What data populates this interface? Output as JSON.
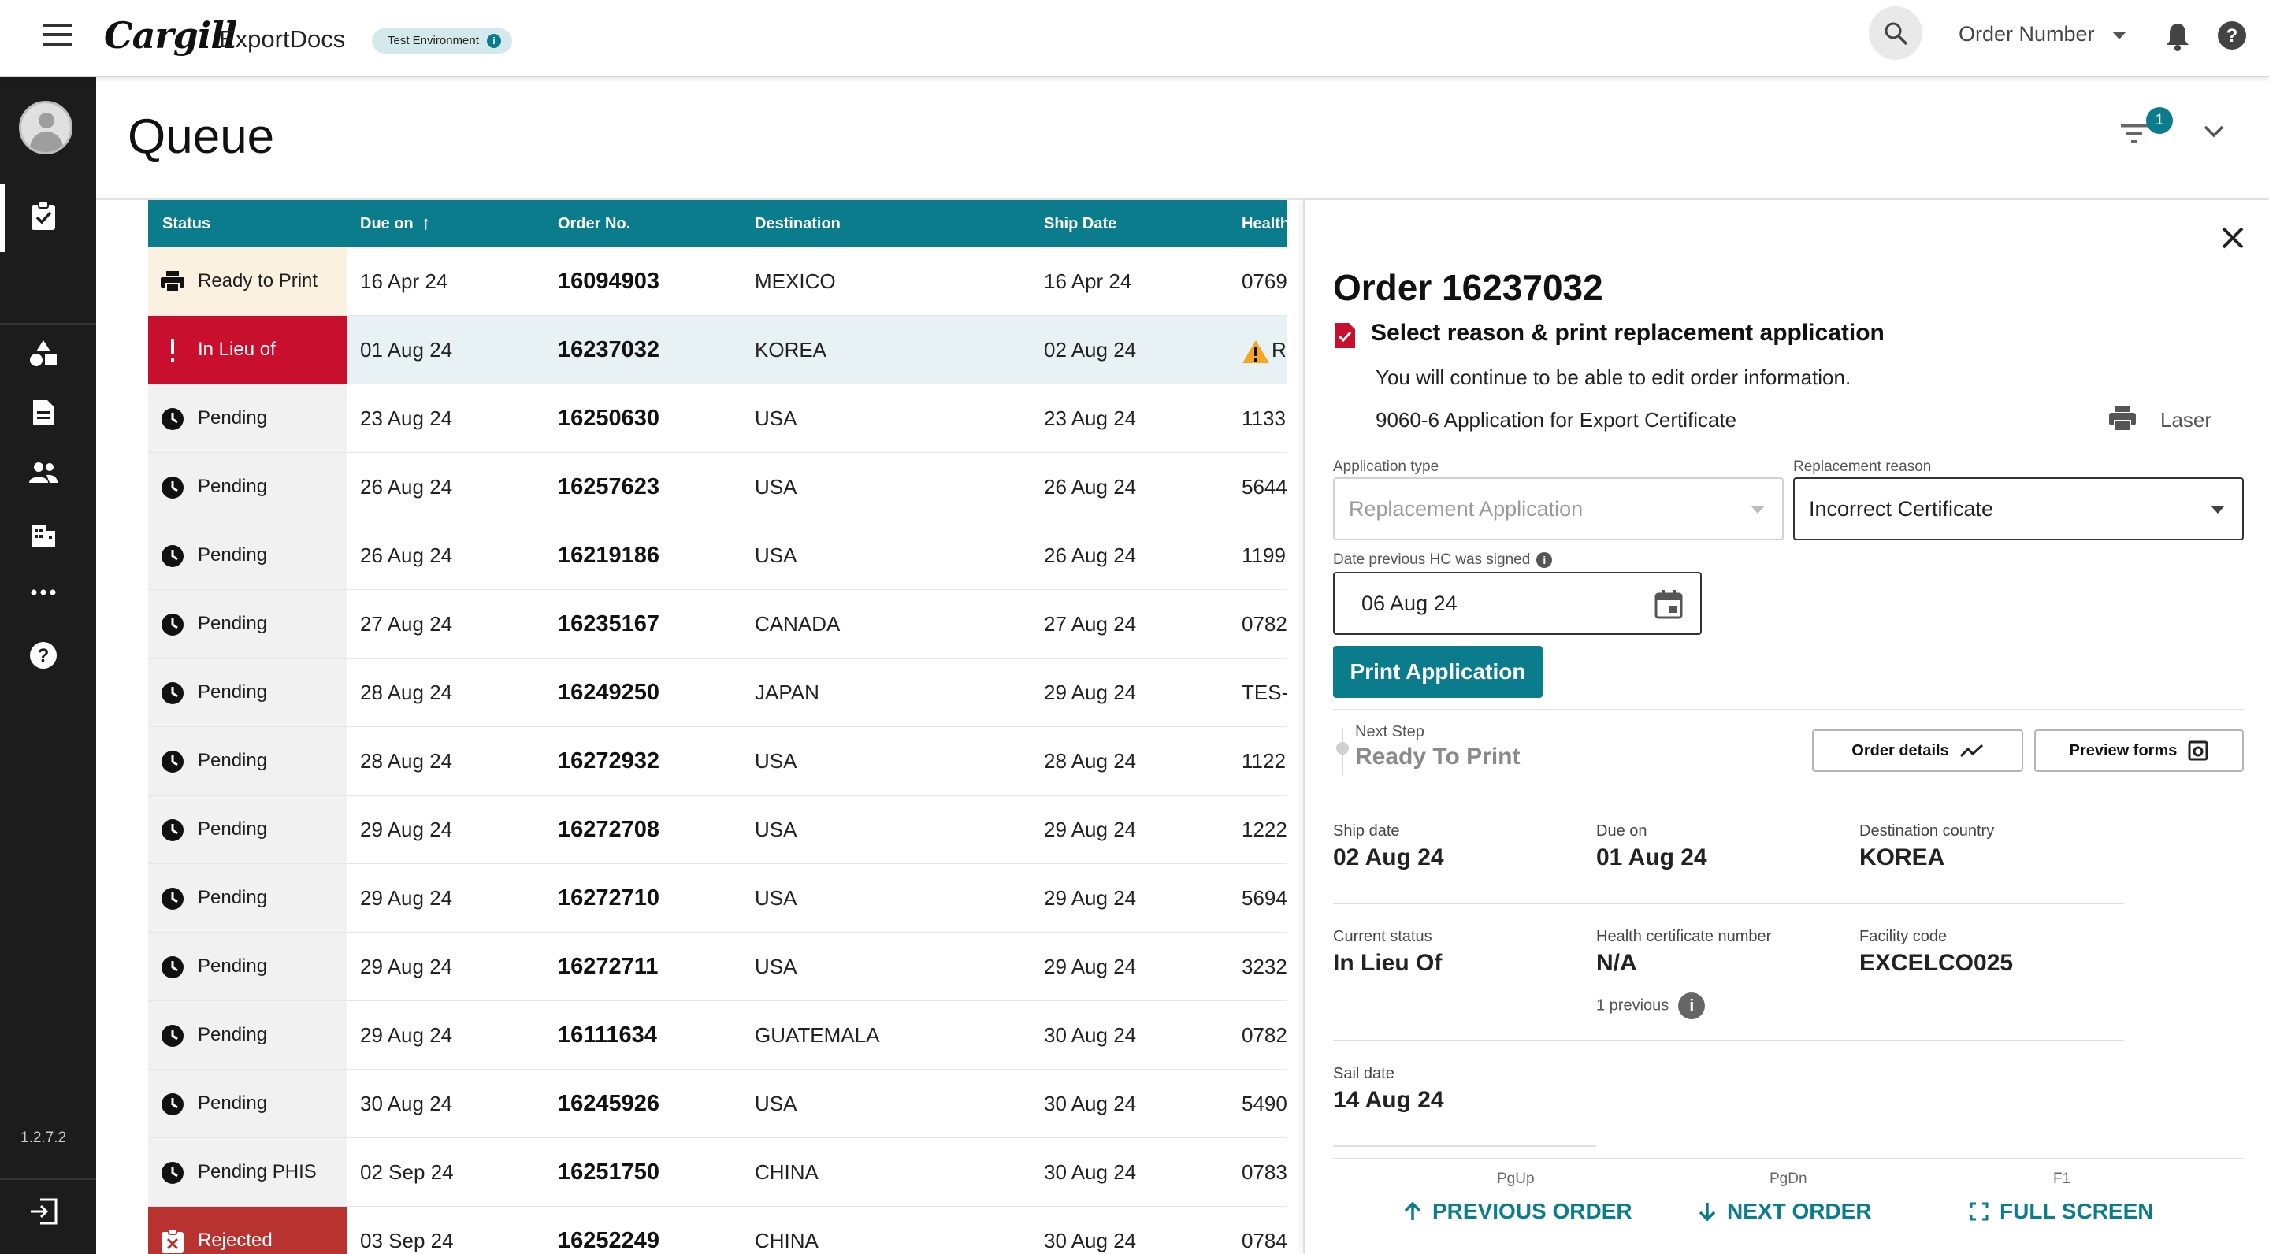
{
  "header": {
    "brand": "Cargill",
    "app_name": "ExportDocs",
    "env_badge": "Test Environment",
    "order_search_label": "Order Number"
  },
  "sidebar": {
    "version": "1.2.7.2",
    "items": [
      {
        "icon": "task-check-icon"
      },
      {
        "icon": "shapes-icon"
      },
      {
        "icon": "document-icon"
      },
      {
        "icon": "people-icon"
      },
      {
        "icon": "building-icon"
      },
      {
        "icon": "more-icon"
      },
      {
        "icon": "help-icon"
      },
      {
        "icon": "logout-icon"
      }
    ]
  },
  "page": {
    "title": "Queue",
    "filter_count": "1"
  },
  "table": {
    "columns": [
      "Status",
      "Due on",
      "Order No.",
      "Destination",
      "Ship Date",
      "Health"
    ],
    "rows": [
      {
        "status": "Ready to Print",
        "due": "16 Apr 24",
        "order": "16094903",
        "dest": "MEXICO",
        "ship": "16 Apr 24",
        "health": "0769"
      },
      {
        "status": "In Lieu of",
        "due": "01 Aug 24",
        "order": "16237032",
        "dest": "KOREA",
        "ship": "02 Aug 24",
        "health": "R"
      },
      {
        "status": "Pending",
        "due": "23 Aug 24",
        "order": "16250630",
        "dest": "USA",
        "ship": "23 Aug 24",
        "health": "1133"
      },
      {
        "status": "Pending",
        "due": "26 Aug 24",
        "order": "16257623",
        "dest": "USA",
        "ship": "26 Aug 24",
        "health": "5644"
      },
      {
        "status": "Pending",
        "due": "26 Aug 24",
        "order": "16219186",
        "dest": "USA",
        "ship": "26 Aug 24",
        "health": "1199"
      },
      {
        "status": "Pending",
        "due": "27 Aug 24",
        "order": "16235167",
        "dest": "CANADA",
        "ship": "27 Aug 24",
        "health": "0782"
      },
      {
        "status": "Pending",
        "due": "28 Aug 24",
        "order": "16249250",
        "dest": "JAPAN",
        "ship": "29 Aug 24",
        "health": "TES-"
      },
      {
        "status": "Pending",
        "due": "28 Aug 24",
        "order": "16272932",
        "dest": "USA",
        "ship": "28 Aug 24",
        "health": "1122"
      },
      {
        "status": "Pending",
        "due": "29 Aug 24",
        "order": "16272708",
        "dest": "USA",
        "ship": "29 Aug 24",
        "health": "1222"
      },
      {
        "status": "Pending",
        "due": "29 Aug 24",
        "order": "16272710",
        "dest": "USA",
        "ship": "29 Aug 24",
        "health": "5694"
      },
      {
        "status": "Pending",
        "due": "29 Aug 24",
        "order": "16272711",
        "dest": "USA",
        "ship": "29 Aug 24",
        "health": "3232"
      },
      {
        "status": "Pending",
        "due": "29 Aug 24",
        "order": "16111634",
        "dest": "GUATEMALA",
        "ship": "30 Aug 24",
        "health": "0782"
      },
      {
        "status": "Pending",
        "due": "30 Aug 24",
        "order": "16245926",
        "dest": "USA",
        "ship": "30 Aug 24",
        "health": "5490"
      },
      {
        "status": "Pending PHIS",
        "due": "02 Sep 24",
        "order": "16251750",
        "dest": "CHINA",
        "ship": "30 Aug 24",
        "health": "0783"
      },
      {
        "status": "Rejected",
        "due": "03 Sep 24",
        "order": "16252249",
        "dest": "CHINA",
        "ship": "30 Aug 24",
        "health": "0784"
      }
    ]
  },
  "panel": {
    "title": "Order 16237032",
    "subtitle": "Select reason & print replacement application",
    "note": "You will continue to be able to edit order information.",
    "application_name": "9060-6 Application for Export Certificate",
    "printer_label": "Laser",
    "application_type_label": "Application type",
    "application_type_value": "Replacement Application",
    "replacement_reason_label": "Replacement reason",
    "replacement_reason_value": "Incorrect Certificate",
    "date_label": "Date previous HC was signed",
    "date_value": "06 Aug 24",
    "print_button": "Print Application",
    "next_step_label": "Next Step",
    "next_step_value": "Ready To Print",
    "order_details_button": "Order details",
    "preview_forms_button": "Preview forms",
    "details": {
      "ship_date_label": "Ship date",
      "ship_date": "02 Aug 24",
      "due_on_label": "Due on",
      "due_on": "01 Aug 24",
      "destination_label": "Destination country",
      "destination": "KOREA",
      "status_label": "Current status",
      "status": "In Lieu Of",
      "hc_label": "Health certificate number",
      "hc": "N/A",
      "hc_previous": "1 previous",
      "facility_label": "Facility code",
      "facility": "EXCELCO025",
      "sail_label": "Sail date",
      "sail": "14 Aug 24"
    },
    "nav": {
      "prev_key": "PgUp",
      "prev_label": "PREVIOUS ORDER",
      "next_key": "PgDn",
      "next_label": "NEXT ORDER",
      "full_key": "F1",
      "full_label": "FULL SCREEN"
    }
  },
  "colors": {
    "accent": "#0b7c8c",
    "alert": "#c8102e",
    "rejected": "#b8332f",
    "ready_bg": "#fbf1e1",
    "warning": "#f5a623"
  }
}
